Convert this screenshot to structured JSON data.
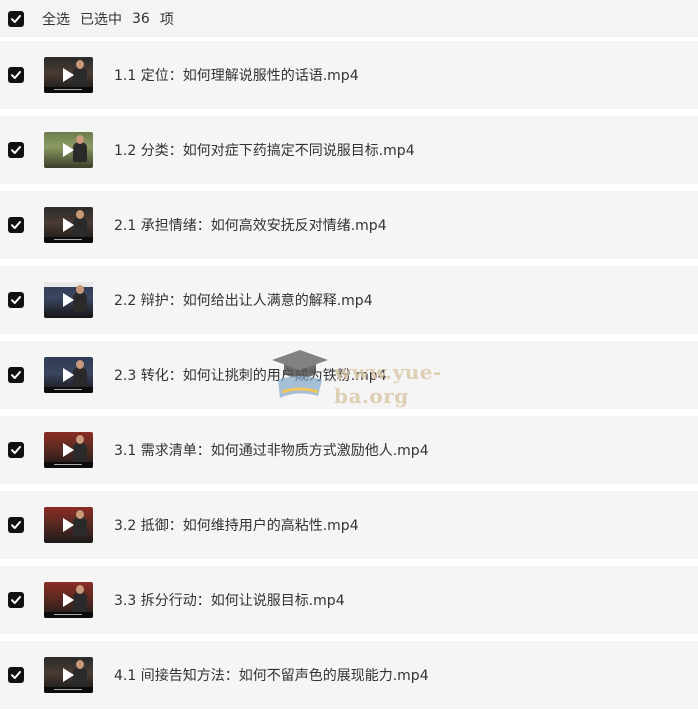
{
  "header": {
    "select_all_label": "全选",
    "selected_prefix": "已选中",
    "selected_count": "36",
    "selected_suffix": "项"
  },
  "files": [
    {
      "title": "1.1 定位：如何理解说服性的话语.mp4"
    },
    {
      "title": "1.2 分类：如何对症下药搞定不同说服目标.mp4"
    },
    {
      "title": "2.1 承担情绪：如何高效安抚反对情绪.mp4"
    },
    {
      "title": "2.2 辩护：如何给出让人满意的解释.mp4"
    },
    {
      "title": "2.3 转化：如何让挑刺的用户成为铁粉.mp4"
    },
    {
      "title": "3.1 需求清单：如何通过非物质方式激励他人.mp4"
    },
    {
      "title": "3.2 抵御：如何维持用户的高粘性.mp4"
    },
    {
      "title": "3.3 拆分行动：如何让说服目标.mp4"
    },
    {
      "title": "4.1 间接告知方法：如何不留声色的展现能力.mp4"
    }
  ],
  "watermark": {
    "text": "www.yue-ba.org"
  },
  "colors": {
    "checkbox": "#111111",
    "row_bg": "#f5f5f6",
    "header_bg": "#f3f4f6"
  }
}
